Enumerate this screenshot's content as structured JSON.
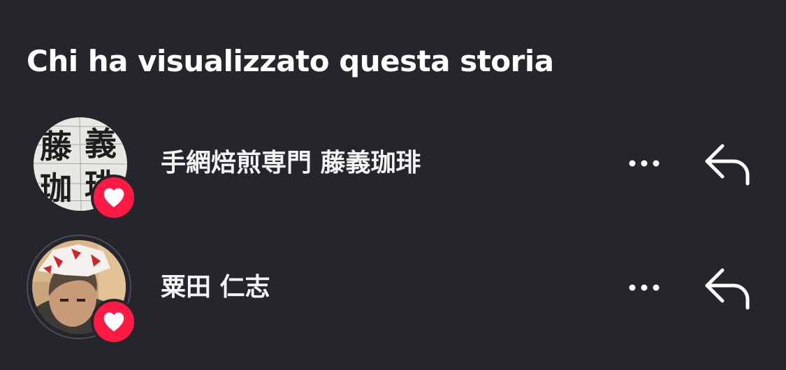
{
  "header": {
    "title": "Chi ha visualizzato questa storia"
  },
  "viewers": [
    {
      "name": "手網焙煎専門 藤義珈琲",
      "avatar_icon": "calligraphy-stamp-logo",
      "reaction_icon": "heart-icon",
      "logo_text": [
        "藤",
        "義",
        "珈",
        "琲"
      ]
    },
    {
      "name": "粟田 仁志",
      "avatar_icon": "user-photo",
      "reaction_icon": "heart-icon"
    }
  ],
  "colors": {
    "background": "#24262b",
    "text": "#ffffff",
    "heart_badge": "#ff1a44",
    "avatar_ring": "#4a4d55"
  },
  "icons": {
    "more": "more-horizontal-icon",
    "reply": "reply-arrow-icon",
    "reaction": "heart-icon"
  }
}
